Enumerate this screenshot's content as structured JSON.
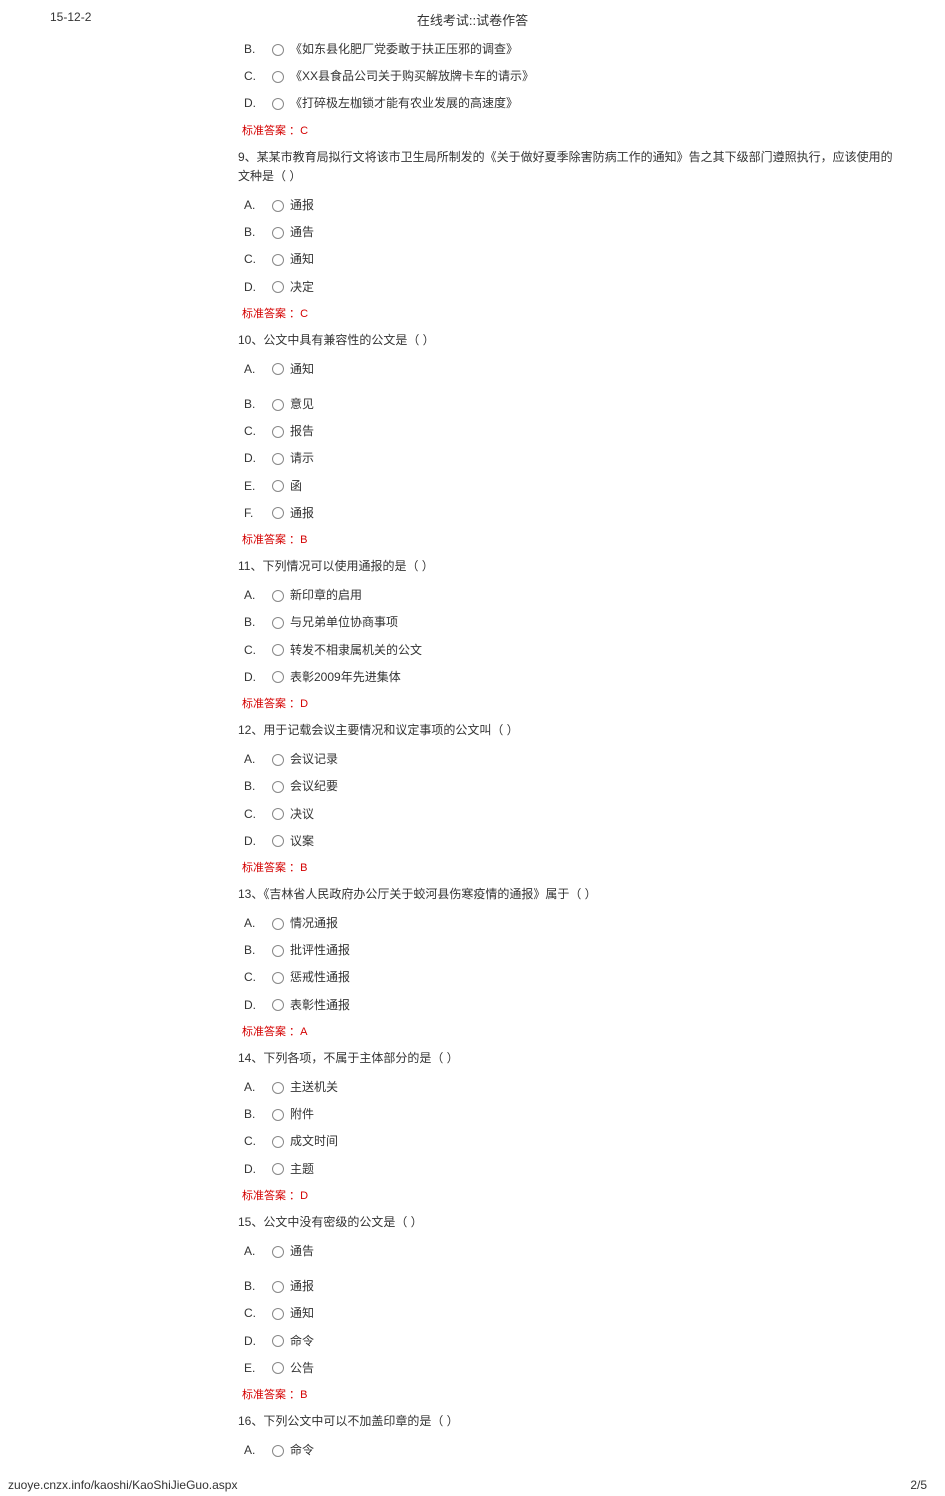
{
  "header": {
    "date": "15-12-2",
    "title": "在线考试::试卷作答"
  },
  "answer_prefix": "标准答案 ：",
  "q8_partial": {
    "options": {
      "B": "《如东县化肥厂党委敢于扶正压邪的调查》",
      "C": "《XX县食品公司关于购买解放牌卡车的请示》",
      "D": "《打碎极左枷锁才能有农业发展的高速度》"
    },
    "answer": "C"
  },
  "q9": {
    "stem": "9、某某市教育局拟行文将该市卫生局所制发的《关于做好夏季除害防病工作的通知》告之其下级部门遵照执行，应该使用的文种是（ ）",
    "options": {
      "A": "通报",
      "B": "通告",
      "C": "通知",
      "D": "决定"
    },
    "answer": "C"
  },
  "q10": {
    "stem": "10、公文中具有兼容性的公文是（ ）",
    "options": {
      "A": "通知",
      "B": "意见",
      "C": "报告",
      "D": "请示",
      "E": "函",
      "F": "通报"
    },
    "answer": "B"
  },
  "q11": {
    "stem": "11、下列情况可以使用通报的是（ ）",
    "options": {
      "A": "新印章的启用",
      "B": "与兄弟单位协商事项",
      "C": "转发不相隶属机关的公文",
      "D": "表彰2009年先进集体"
    },
    "answer": "D"
  },
  "q12": {
    "stem": "12、用于记载会议主要情况和议定事项的公文叫（ ）",
    "options": {
      "A": "会议记录",
      "B": "会议纪要",
      "C": "决议",
      "D": "议案"
    },
    "answer": "B"
  },
  "q13": {
    "stem": "13、《吉林省人民政府办公厅关于蛟河县伤寒疫情的通报》属于（ ）",
    "options": {
      "A": "情况通报",
      "B": "批评性通报",
      "C": "惩戒性通报",
      "D": "表彰性通报"
    },
    "answer": "A"
  },
  "q14": {
    "stem": "14、下列各项，不属于主体部分的是（ ）",
    "options": {
      "A": "主送机关",
      "B": "附件",
      "C": "成文时间",
      "D": "主题"
    },
    "answer": "D"
  },
  "q15": {
    "stem": "15、公文中没有密级的公文是（ ）",
    "options": {
      "A": "通告",
      "B": "通报",
      "C": "通知",
      "D": "命令",
      "E": "公告"
    },
    "answer": "B"
  },
  "q16_partial": {
    "stem": "16、下列公文中可以不加盖印章的是（ ）",
    "options": {
      "A": "命令"
    }
  },
  "footer": {
    "url": "zuoye.cnzx.info/kaoshi/KaoShiJieGuo.aspx",
    "page": "2/5"
  }
}
